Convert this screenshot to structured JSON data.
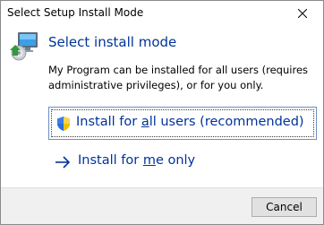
{
  "window": {
    "title": "Select Setup Install Mode"
  },
  "header": {
    "heading": "Select install mode",
    "description": "My Program can be installed for all users (requires administrative privileges), or for you only."
  },
  "options": [
    {
      "label_pre": "Install for ",
      "label_ul": "a",
      "label_post": "ll users (recommended)",
      "icon": "shield-icon"
    },
    {
      "label_pre": "Install for ",
      "label_ul": "m",
      "label_post": "e only",
      "icon": "arrow-right-icon"
    }
  ],
  "footer": {
    "cancel_label": "Cancel"
  },
  "colors": {
    "link_blue": "#003399",
    "footer_bg": "#f0f0f0"
  }
}
